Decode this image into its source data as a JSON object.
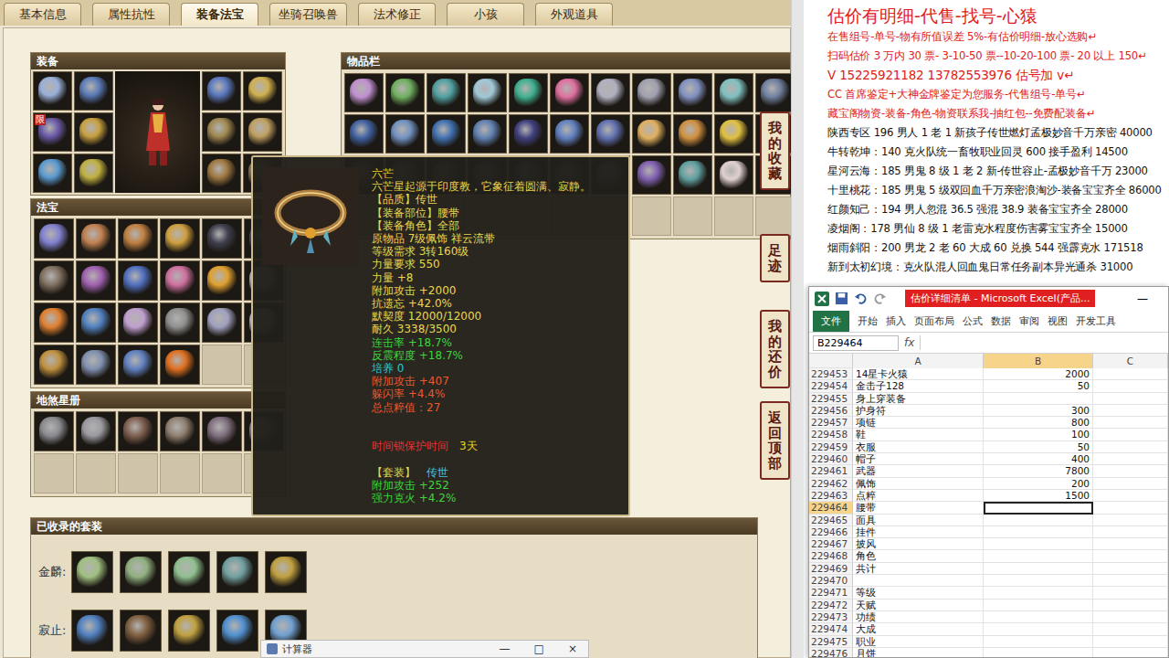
{
  "tabs": [
    {
      "label": "基本信息",
      "selected": false
    },
    {
      "label": "属性抗性",
      "selected": false
    },
    {
      "label": "装备法宝",
      "selected": true
    },
    {
      "label": "坐骑召唤兽",
      "selected": false
    },
    {
      "label": "法术修正",
      "selected": false
    },
    {
      "label": "小孩",
      "selected": false
    },
    {
      "label": "外观道具",
      "selected": false
    }
  ],
  "equipment": {
    "title": "装备",
    "left": [
      {
        "color": "#9ab0d8"
      },
      {
        "color": "#5a7ab8"
      },
      {
        "color": "#6a5aa8",
        "badge": "限"
      },
      {
        "color": "#c8a040"
      },
      {
        "color": "#5a9ad0"
      },
      {
        "color": "#c0b040"
      }
    ],
    "right": [
      {
        "color": "#5a78c0"
      },
      {
        "color": "#d0b050"
      },
      {
        "color": "#a08850"
      },
      {
        "color": "#c0a060"
      },
      {
        "color": "#a07840"
      },
      {
        "color": "#8a7a60"
      }
    ]
  },
  "inventory": {
    "title": "物品栏",
    "rows": [
      [
        "#c090d0",
        "#70b060",
        "#50a0a0",
        "#a0c8d8",
        "#40b090",
        "#e070a0",
        "#b0b0c0",
        "#a0a0b0",
        "#8090c0",
        "#80c0c0",
        "#7080a0"
      ],
      [
        "#4060a0",
        "#7090c0",
        "#4070b0",
        "#6080b0",
        "#404080",
        "#6080c0",
        "#6070b0",
        "#e0b060",
        "#d09040",
        "#e0c040",
        "#5070b0"
      ],
      [
        "#7060a0",
        "#5080b0",
        "#6070a0",
        "#8070b0",
        "#6060a0",
        "#5070a0",
        "#7080b0",
        "#8060b0",
        "#60a0a0",
        "#e0d0d0",
        "#9080a0"
      ],
      [
        null,
        null,
        null,
        null,
        null,
        null,
        null,
        null,
        null,
        null,
        null
      ]
    ]
  },
  "fabao": {
    "title": "法宝",
    "slots": [
      "#8080d0",
      "#c08050",
      "#c08040",
      "#d0a040",
      "#404050",
      "#505060",
      "#807060",
      "#a060b0",
      "#5070c0",
      "#d070a0",
      "#e0a030",
      "#c0c0c0",
      "#e08030",
      "#5080c0",
      "#c0a0d0",
      "#909090",
      "#a0a0c0",
      "#c0c0d0",
      "#c09040",
      "#8090b0",
      "#6080c0",
      "#e07020",
      null,
      null
    ]
  },
  "disha": {
    "title": "地煞星册",
    "slots": [
      "#8a8a90",
      "#9a9aa0",
      "#806050",
      "#908070",
      "#807080",
      "#908890",
      null,
      null,
      null,
      null,
      null,
      null
    ]
  },
  "sets": {
    "title": "已收录的套装",
    "groups": [
      {
        "label": "金麟:",
        "items": [
          "#a0c080",
          "#90b080",
          "#90c090",
          "#70a0a0",
          "#c0a040"
        ]
      },
      {
        "label": "寂止:",
        "items": [
          "#5080c0",
          "#806040",
          "#c0a040",
          "#5090d0",
          "#70a0d0"
        ]
      }
    ]
  },
  "side_buttons": [
    "我的收藏",
    "足迹",
    "我的还价",
    "返回顶部"
  ],
  "tooltip": {
    "image_color": "#b08040",
    "lines": [
      [
        {
          "text": "六芒",
          "color": "#f0d020"
        }
      ],
      [
        {
          "text": "六芒星起源于印度教，它象征着圆满、寂静。",
          "color": "#e8d24a"
        }
      ],
      [
        {
          "text": "【品质】传世",
          "color": "#e8d850"
        }
      ],
      [
        {
          "text": "【装备部位】腰带",
          "color": "#e8d850"
        }
      ],
      [
        {
          "text": "【装备角色】全部",
          "color": "#e8d850"
        }
      ],
      [
        {
          "text": "原物品 7级佩饰 祥云流带",
          "color": "#e8d850"
        }
      ],
      [
        {
          "text": "等级需求 3转160级",
          "color": "#e8d850"
        }
      ],
      [
        {
          "text": "力量要求 550",
          "color": "#e8d850"
        }
      ],
      [
        {
          "text": "力量 +8",
          "color": "#e8d850"
        }
      ],
      [
        {
          "text": "附加攻击 +2000",
          "color": "#e8d850"
        }
      ],
      [
        {
          "text": "抗遗忘 +42.0%",
          "color": "#e8d850"
        }
      ],
      [
        {
          "text": "默契度 12000/12000",
          "color": "#e8d850"
        }
      ],
      [
        {
          "text": "耐久 3338/3500",
          "color": "#e8d850"
        }
      ],
      [
        {
          "text": "连击率 +18.7%",
          "color": "#3cd63c"
        }
      ],
      [
        {
          "text": "反震程度 +18.7%",
          "color": "#3cd63c"
        }
      ],
      [
        {
          "text": "培养 0",
          "color": "#30c8c8"
        }
      ],
      [
        {
          "text": "附加攻击 +407",
          "color": "#e85a30"
        }
      ],
      [
        {
          "text": "躲闪率 +4.4%",
          "color": "#e85a30"
        }
      ],
      [
        {
          "text": "总点粹值：27",
          "color": "#e85a30"
        }
      ],
      [],
      [],
      [
        {
          "text": "时间锁保护时间",
          "color": "#e83030"
        },
        {
          "text": "3天",
          "color": "#f0d020"
        }
      ],
      [],
      [
        {
          "text": "【套装】",
          "color": "#e8d850"
        },
        {
          "text": "传世",
          "color": "#40c8e0"
        }
      ],
      [
        {
          "text": "附加攻击 +252",
          "color": "#3cd63c"
        }
      ],
      [
        {
          "text": "强力克火 +4.2%",
          "color": "#3cd63c"
        }
      ]
    ]
  },
  "calculator": {
    "title": "计算器",
    "controls": [
      "—",
      "□",
      "×"
    ]
  },
  "document": {
    "title": "估价有明细-代售-找号-心猿",
    "red_lines": [
      "在售组号-单号-物有所值误差 5%-有估价明细-放心选购↵",
      "扫码估价 3 万内 30 票- 3-10-50 票--10-20-100 票- 20 以上 150↵",
      "V 15225921182   13782553976   估号加 v↵",
      "CC 首席鉴定+大神金牌鉴定为您服务-代售组号-单号↵",
      "藏宝阁物资-装备-角色-物资联系我-抽红包--免费配装备↵"
    ],
    "black_lines": [
      "陕西专区 196 男人 1 老 1 新孩子传世燃灯孟极妙音千万亲密 40000",
      "牛转乾坤：140 克火队统一畜牧职业回灵 600 接手盈利 14500",
      "星河云海：185 男鬼 8 级 1 老 2 新-传世容止-孟极妙音千万 23000",
      "十里桃花：185 男鬼 5 级双回血千万亲密浪淘沙-装备宝宝齐全 86000",
      "红颜知己：194 男人忽混 36.5 强混 38.9 装备宝宝齐全 28000",
      "凌烟阁：178 男仙 8 级 1 老雷克水程度伤害雾宝宝齐全 15000",
      "烟雨斜阳：200 男龙 2 老 60 大成 60 兑换 544 强霹克水 171518",
      "新到太初幻境：克火队混人回血鬼日常任务副本异光通杀 31000"
    ]
  },
  "excel": {
    "title": "估价详细清单 - Microsoft Excel(产品...",
    "controls": [
      "—"
    ],
    "tabs": [
      {
        "label": "文件",
        "selected": true
      },
      {
        "label": "开始",
        "selected": false
      },
      {
        "label": "插入",
        "selected": false
      },
      {
        "label": "页面布局",
        "selected": false
      },
      {
        "label": "公式",
        "selected": false
      },
      {
        "label": "数据",
        "selected": false
      },
      {
        "label": "审阅",
        "selected": false
      },
      {
        "label": "视图",
        "selected": false
      },
      {
        "label": "开发工具",
        "selected": false
      }
    ],
    "name_box": "B229464",
    "fx": "fx",
    "columns": [
      {
        "label": "A",
        "selected": false
      },
      {
        "label": "B",
        "selected": true
      },
      {
        "label": "C",
        "selected": false
      }
    ],
    "rows": [
      {
        "num": "229453",
        "a": "14星卡火猿",
        "b": "2000",
        "selected": false
      },
      {
        "num": "229454",
        "a": "金击子128",
        "b": "50",
        "selected": false
      },
      {
        "num": "229455",
        "a": "身上穿装备",
        "b": "",
        "selected": false
      },
      {
        "num": "229456",
        "a": "护身符",
        "b": "300",
        "selected": false
      },
      {
        "num": "229457",
        "a": "项链",
        "b": "800",
        "selected": false
      },
      {
        "num": "229458",
        "a": "鞋",
        "b": "100",
        "selected": false
      },
      {
        "num": "229459",
        "a": "衣服",
        "b": "50",
        "selected": false
      },
      {
        "num": "229460",
        "a": "帽子",
        "b": "400",
        "selected": false
      },
      {
        "num": "229461",
        "a": "武器",
        "b": "7800",
        "selected": false
      },
      {
        "num": "229462",
        "a": "佩饰",
        "b": "200",
        "selected": false
      },
      {
        "num": "229463",
        "a": "点粹",
        "b": "1500",
        "selected": false
      },
      {
        "num": "229464",
        "a": "腰带",
        "b": "",
        "selected": true
      },
      {
        "num": "229465",
        "a": "面具",
        "b": "",
        "selected": false
      },
      {
        "num": "229466",
        "a": "挂件",
        "b": "",
        "selected": false
      },
      {
        "num": "229467",
        "a": "披风",
        "b": "",
        "selected": false
      },
      {
        "num": "229468",
        "a": "角色",
        "b": "",
        "selected": false
      },
      {
        "num": "229469",
        "a": "共计",
        "b": "",
        "selected": false
      },
      {
        "num": "229470",
        "a": "",
        "b": "",
        "selected": false
      },
      {
        "num": "229471",
        "a": "等级",
        "b": "",
        "selected": false
      },
      {
        "num": "229472",
        "a": "天赋",
        "b": "",
        "selected": false
      },
      {
        "num": "229473",
        "a": "功绩",
        "b": "",
        "selected": false
      },
      {
        "num": "229474",
        "a": "大成",
        "b": "",
        "selected": false
      },
      {
        "num": "229475",
        "a": "职业",
        "b": "",
        "selected": false
      },
      {
        "num": "229476",
        "a": "月饼",
        "b": "",
        "selected": false
      }
    ]
  }
}
